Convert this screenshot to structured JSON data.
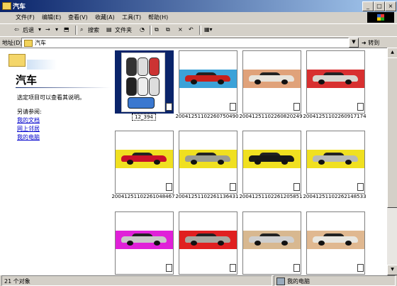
{
  "window": {
    "title": "汽车"
  },
  "title_buttons": [
    "_",
    "□",
    "×"
  ],
  "menu": [
    "文件(F)",
    "编辑(E)",
    "查看(V)",
    "收藏(A)",
    "工具(T)",
    "帮助(H)"
  ],
  "toolbar": {
    "back": "后退",
    "forward": "→",
    "search": "搜索",
    "folders": "文件夹",
    "delete": "×"
  },
  "address": {
    "label": "地址(D)",
    "value": "汽车",
    "go": "转到"
  },
  "left_pane": {
    "title": "汽车",
    "description": "选定项目可以查看其说明。",
    "see_also": "另请参阅:",
    "links": [
      "我的文档",
      "网上邻居",
      "我的电脑"
    ]
  },
  "thumbnails": [
    {
      "caption": "12_394",
      "band": "",
      "car": ""
    },
    {
      "caption": "20041251102260750490",
      "band": "#3ba2d8",
      "car": "#c8201c"
    },
    {
      "caption": "20041251102260820249",
      "band": "#e0a27a",
      "car": "#e8e4dc"
    },
    {
      "caption": "20041251102260917174",
      "band": "#d83030",
      "car": "#d8d6d0"
    },
    {
      "caption": "20041251102261048467",
      "band": "#f0e020",
      "car": "#c8102a"
    },
    {
      "caption": "20041251102261136431",
      "band": "#f0e020",
      "car": "#9a9c92"
    },
    {
      "caption": "20041251102261205851",
      "band": "#f0e020",
      "car": "#181818"
    },
    {
      "caption": "20041251102262148533",
      "band": "#f0e020",
      "car": "#b8bab6"
    },
    {
      "caption": "",
      "band": "#e020d8",
      "car": "#c8c8c8"
    },
    {
      "caption": "",
      "band": "#e02020",
      "car": "#a8a8a0"
    },
    {
      "caption": "",
      "band": "#d8b890",
      "car": "#cfcfcf"
    },
    {
      "caption": "",
      "band": "#e0b890",
      "car": "#e8e6e0"
    }
  ],
  "status": {
    "count": "21 个对象",
    "location": "我的电脑"
  }
}
